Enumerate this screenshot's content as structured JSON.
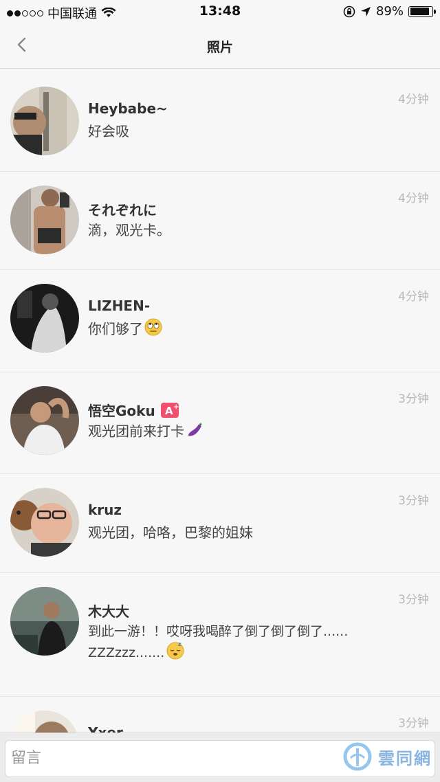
{
  "status": {
    "carrier": "中国联通",
    "time": "13:48",
    "battery": "89%",
    "battery_level": 0.89
  },
  "nav": {
    "title": "照片"
  },
  "comments": [
    {
      "name": "Heybabe~",
      "message": "好会吸",
      "time": "4分钟"
    },
    {
      "name": "それぞれに",
      "message": "滴，观光卡。",
      "time": "4分钟"
    },
    {
      "name": "LIZHEN-",
      "message": "你们够了",
      "time": "4分钟",
      "emoji": "eye-roll-emoji"
    },
    {
      "name": "悟空Goku",
      "message": "观光团前来打卡",
      "time": "3分钟",
      "badge": "A",
      "emoji": "eggplant-emoji"
    },
    {
      "name": "kruz",
      "message": "观光团，哈咯，巴黎的姐妹",
      "time": "3分钟"
    },
    {
      "name": "木大大",
      "message": "到此一游！！哎呀我喝醉了倒了倒了倒了......",
      "message2": "ZZZzzz.......",
      "time": "3分钟",
      "emoji": "sleeping-emoji"
    },
    {
      "name": "Yxer.",
      "message": "",
      "time": "3分钟"
    }
  ],
  "input": {
    "placeholder": "留言"
  },
  "watermark": {
    "text": "雲同網"
  }
}
